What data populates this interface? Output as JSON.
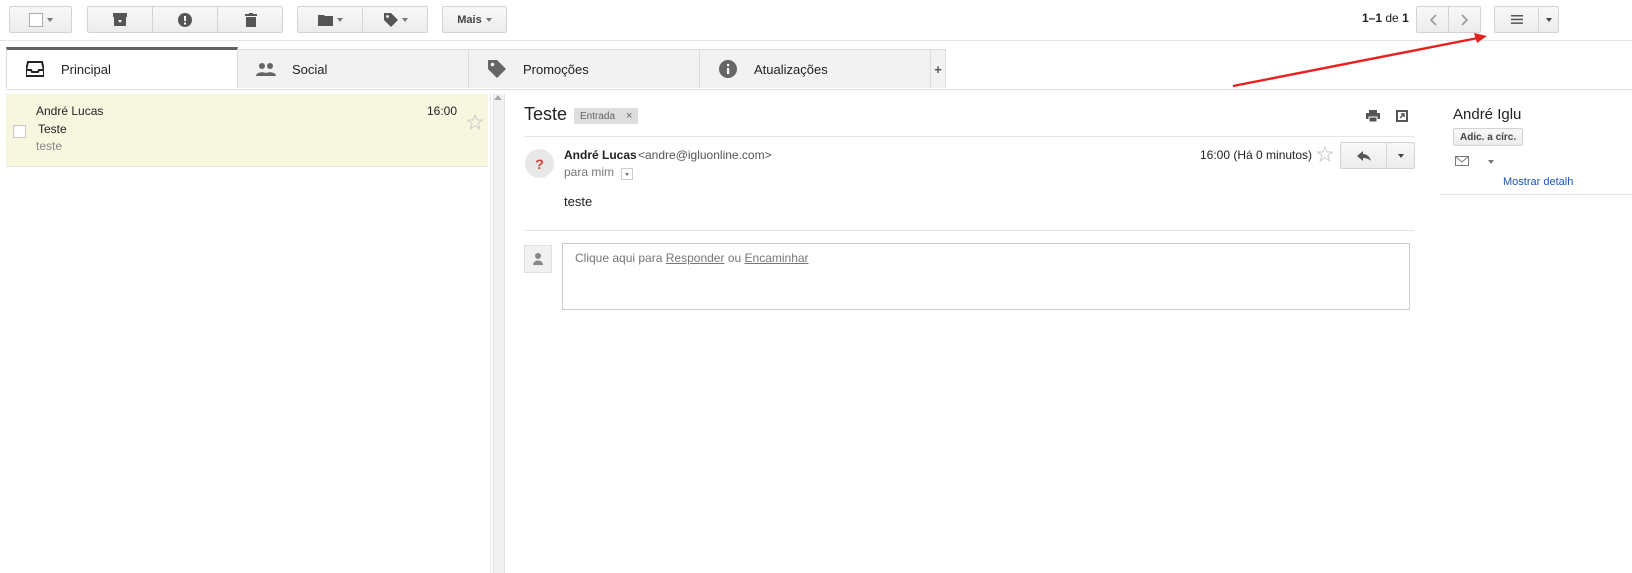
{
  "toolbar": {
    "more_label": "Mais",
    "pagination": {
      "range": "1–1",
      "of_label": "de",
      "total": "1"
    }
  },
  "tabs": [
    {
      "label": "Principal",
      "icon": "inbox-icon"
    },
    {
      "label": "Social",
      "icon": "people-icon"
    },
    {
      "label": "Promoções",
      "icon": "tag-icon"
    },
    {
      "label": "Atualizações",
      "icon": "info-icon"
    }
  ],
  "add_tab_label": "+",
  "message_list": [
    {
      "sender": "André Lucas",
      "time": "16:00",
      "subject": "Teste",
      "snippet": "teste"
    }
  ],
  "email": {
    "subject": "Teste",
    "label_chip": "Entrada",
    "label_remove": "×",
    "sender_name": "André Lucas",
    "sender_email": "<andre@igluonline.com>",
    "recipient": "para mim",
    "timestamp": "16:00 (Há 0 minutos)",
    "body": "teste",
    "avatar_glyph": "?"
  },
  "reply_box": {
    "prefix": "Clique aqui para",
    "reply_link": "Responder",
    "or": "ou",
    "forward_link": "Encaminhar"
  },
  "contact_card": {
    "name": "André Iglu",
    "add_circle_label": "Adic. a círc.",
    "show_details_link": "Mostrar detalh"
  },
  "colors": {
    "selected_row": "#f7f7e0",
    "annotation_arrow": "#e8211f",
    "link_blue": "#1a55b0",
    "avatar_question": "#d23f31"
  }
}
